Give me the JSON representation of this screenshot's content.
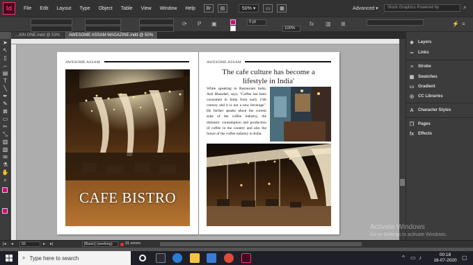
{
  "app": {
    "logo": "Id",
    "zoom": "50%",
    "workspace": "Advanced",
    "search_placeholder": "Stock Graphics Powered by"
  },
  "menu": [
    "File",
    "Edit",
    "Layout",
    "Type",
    "Object",
    "Table",
    "View",
    "Window",
    "Help"
  ],
  "tabs": [
    {
      "label": "...AIN ONE.indd @ 53%",
      "active": false
    },
    {
      "label": "AWESOME ASSAM MAGAZINE.indd @ 50%",
      "active": true
    }
  ],
  "control": {
    "stroke_weight": "0 pt",
    "opacity": "100%",
    "frame_style": "",
    "fill_color": "#e6007e"
  },
  "document": {
    "left_running_head": "AWESOME ASSAM",
    "right_running_head": "AWESOME ASSAM",
    "cafe_title": "CAFE BISTRO",
    "article_title": "The cafe culture has become a lifestyle in India'",
    "article_body": "While speaking to Restaurant India, Anil Bhandari, says, \"Coffee has been consumed in India from early 15th century and it is not a new beverage\". He further speaks about the current state of the coffee industry, the domestic consumption and production of coffee in the country and also the future of the coffee industry in India."
  },
  "panels": [
    {
      "icon": "layers-icon",
      "glyph": "◈",
      "label": "Layers"
    },
    {
      "icon": "links-icon",
      "glyph": "∞",
      "label": "Links"
    },
    {
      "icon": "stroke-icon",
      "glyph": "≡",
      "label": "Stroke"
    },
    {
      "icon": "swatches-icon",
      "glyph": "▦",
      "label": "Swatches"
    },
    {
      "icon": "gradient-icon",
      "glyph": "▭",
      "label": "Gradient"
    },
    {
      "icon": "cc-libraries-icon",
      "glyph": "◎",
      "label": "CC Libraries"
    },
    {
      "icon": "character-styles-icon",
      "glyph": "A",
      "label": "Character Styles"
    },
    {
      "icon": "pages-icon",
      "glyph": "❐",
      "label": "Pages"
    },
    {
      "icon": "effects-icon",
      "glyph": "fx",
      "label": "Effects"
    }
  ],
  "status": {
    "page": "55",
    "preflight_profile": "[Basic] (working)",
    "errors": "31 errors"
  },
  "watermark": {
    "line1": "Activate Windows",
    "line2": "Go to Settings to activate Windows."
  },
  "taskbar": {
    "search_placeholder": "Type here to search",
    "time": "00:18",
    "date": "16-07-2020"
  }
}
